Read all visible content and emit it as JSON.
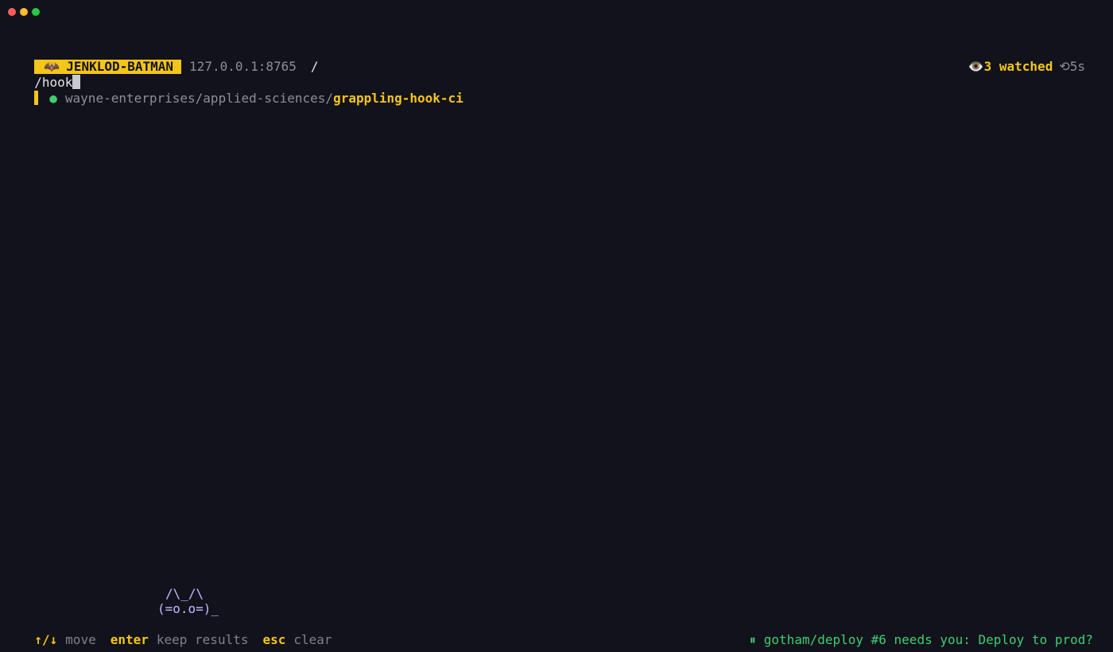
{
  "window": {
    "controls": [
      {
        "name": "close",
        "color": "#ff5f57"
      },
      {
        "name": "minimize",
        "color": "#febc2e"
      },
      {
        "name": "zoom",
        "color": "#28c840"
      }
    ]
  },
  "header": {
    "icon": "bat-icon",
    "title": "JENKLOD-BATMAN",
    "address": "127.0.0.1:8765",
    "path": "/",
    "watched_icon": "eye-icon",
    "watched": "3 watched",
    "refresh_icon": "refresh-icon",
    "refresh": "5s"
  },
  "search": {
    "query": "/hook"
  },
  "results": [
    {
      "status_color": "#3ecf6e",
      "prefix": "wayne-enterprises/applied-sciences/",
      "name": "grappling-hook-ci",
      "selected": true
    }
  ],
  "mascot": {
    "ears": "/\\_/\\",
    "face": "(=o.o=)_"
  },
  "footer": {
    "keys": [
      {
        "key": "↑/↓",
        "label": "move"
      },
      {
        "key": "enter",
        "label": "keep results"
      },
      {
        "key": "esc",
        "label": "clear"
      }
    ],
    "notification_icon": "pause-icon",
    "notification": "gotham/deploy #6 needs you: Deploy to prod?"
  },
  "colors": {
    "background": "#12121c",
    "accent": "#f5c518",
    "success": "#3ecf6e",
    "muted": "#8a8f99",
    "mascot": "#c6b8ff"
  }
}
